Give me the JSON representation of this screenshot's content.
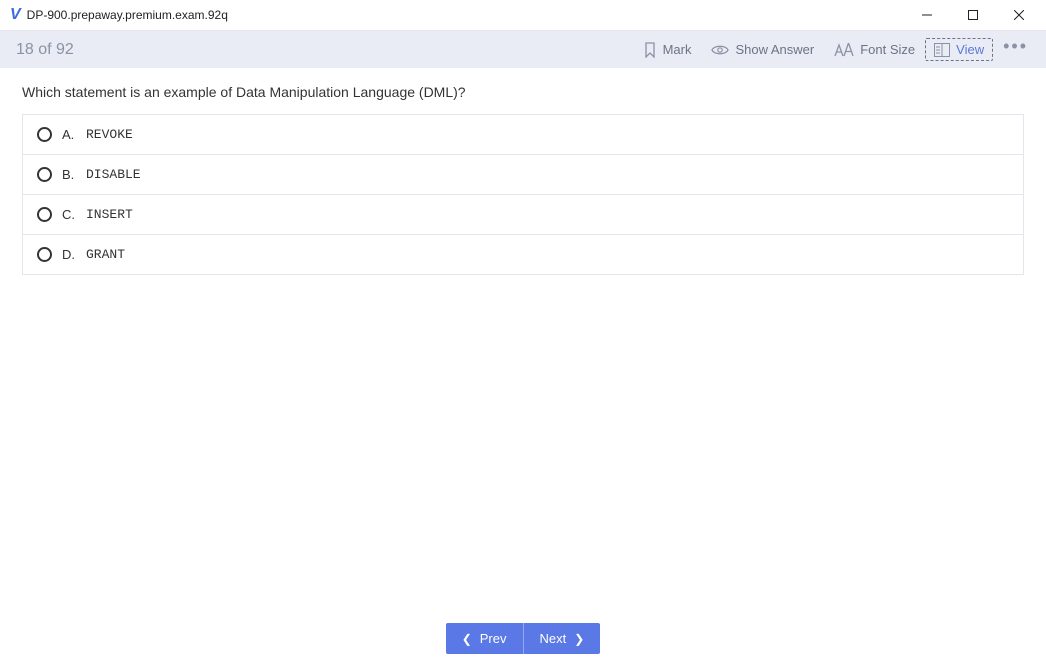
{
  "window": {
    "title": "DP-900.prepaway.premium.exam.92q"
  },
  "toolbar": {
    "counter": "18 of 92",
    "mark": "Mark",
    "show_answer": "Show Answer",
    "font_size": "Font Size",
    "view": "View"
  },
  "question": {
    "text": "Which statement is an example of Data Manipulation Language (DML)?",
    "choices": [
      {
        "letter": "A.",
        "text": "REVOKE"
      },
      {
        "letter": "B.",
        "text": "DISABLE"
      },
      {
        "letter": "C.",
        "text": "INSERT"
      },
      {
        "letter": "D.",
        "text": "GRANT"
      }
    ]
  },
  "nav": {
    "prev": "Prev",
    "next": "Next"
  }
}
